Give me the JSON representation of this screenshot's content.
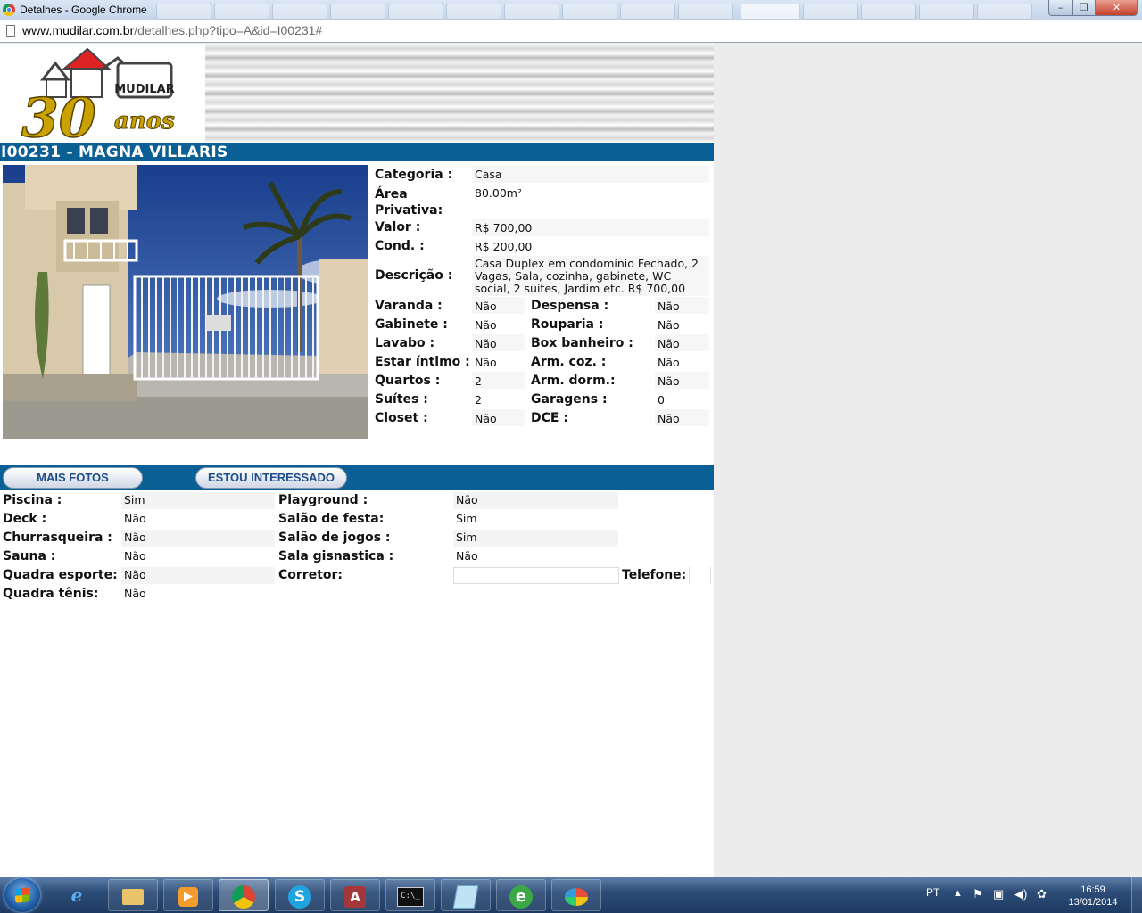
{
  "browser": {
    "window_title": "Detalhes - Google Chrome",
    "url_host": "www.mudilar.com.br",
    "url_path": "/detalhes.php?tipo=A&id=I00231#",
    "min_glyph": "–",
    "max_glyph": "❐",
    "close_glyph": "✕"
  },
  "page": {
    "logo_brand": "MUDILAR",
    "logo_years": "30",
    "logo_anos": "anos",
    "heading": "I00231 - MAGNA VILLARIS",
    "details": {
      "categoria_label": "Categoria :",
      "categoria": "Casa",
      "area_label": "Área Privativa:",
      "area": "80.00m²",
      "valor_label": "Valor :",
      "valor": "R$ 700,00",
      "cond_label": "Cond. :",
      "cond": "R$ 200,00",
      "descricao_label": "Descrição :",
      "descricao": "Casa Duplex em condomínio Fechado, 2 Vagas, Sala, cozinha, gabinete, WC social, 2 suites, Jardim etc. R$ 700,00"
    },
    "features_left": [
      {
        "label": "Varanda :",
        "value": "Não"
      },
      {
        "label": "Gabinete :",
        "value": "Não"
      },
      {
        "label": "Lavabo :",
        "value": "Não"
      },
      {
        "label": "Estar íntimo :",
        "value": "Não"
      },
      {
        "label": "Quartos :",
        "value": "2"
      },
      {
        "label": "Suítes :",
        "value": "2"
      },
      {
        "label": "Closet :",
        "value": "Não"
      }
    ],
    "features_right": [
      {
        "label": "Despensa :",
        "value": "Não"
      },
      {
        "label": "Rouparia :",
        "value": "Não"
      },
      {
        "label": "Box banheiro :",
        "value": "Não"
      },
      {
        "label": "Arm. coz. :",
        "value": "Não"
      },
      {
        "label": "Arm. dorm.:",
        "value": "Não"
      },
      {
        "label": "Garagens :",
        "value": "0"
      },
      {
        "label": "DCE :",
        "value": "Não"
      }
    ],
    "mais_fotos": "MAIS FOTOS",
    "estou_interessado": "ESTOU INTERESSADO",
    "amenities_left": [
      {
        "label": "Piscina :",
        "value": "Sim"
      },
      {
        "label": "Deck :",
        "value": "Não"
      },
      {
        "label": "Churrasqueira :",
        "value": "Não"
      },
      {
        "label": "Sauna :",
        "value": "Não"
      },
      {
        "label": "Quadra esporte:",
        "value": "Não"
      },
      {
        "label": "Quadra tênis:",
        "value": "Não"
      }
    ],
    "amenities_right": [
      {
        "label": "Playground :",
        "value": "Não"
      },
      {
        "label": "Salão de festa:",
        "value": "Sim"
      },
      {
        "label": "Salão de jogos :",
        "value": "Sim"
      },
      {
        "label": "Sala gisnastica :",
        "value": "Não"
      }
    ],
    "corretor_label": "Corretor:",
    "corretor_value": "",
    "telefone_label": "Telefone:",
    "telefone_value": ""
  },
  "taskbar": {
    "apps": [
      "internet-explorer-icon",
      "file-explorer-icon",
      "media-player-icon",
      "chrome-icon",
      "skype-icon",
      "access-icon",
      "cmd-icon",
      "notepad-icon",
      "e-icon",
      "paint-icon"
    ],
    "language": "PT",
    "time": "16:59",
    "date": "13/01/2014"
  }
}
